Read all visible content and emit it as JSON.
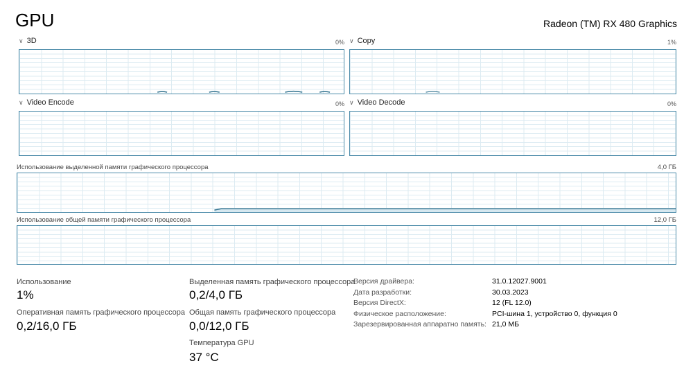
{
  "header": {
    "title": "GPU",
    "device": "Radeon (TM) RX 480 Graphics"
  },
  "engines": [
    {
      "label": "3D",
      "value": "0%"
    },
    {
      "label": "Copy",
      "value": "1%"
    },
    {
      "label": "Video Encode",
      "value": "0%"
    },
    {
      "label": "Video Decode",
      "value": "0%"
    }
  ],
  "memory_graphs": [
    {
      "label": "Использование выделенной памяти графического процессора",
      "max": "4,0 ГБ"
    },
    {
      "label": "Использование общей памяти графического процессора",
      "max": "12,0 ГБ"
    }
  ],
  "stats": {
    "utilization": {
      "label": "Использование",
      "value": "1%"
    },
    "gpu_memory": {
      "label": "Оперативная память графического процессора",
      "value": "0,2/16,0 ГБ"
    },
    "dedicated": {
      "label": "Выделенная память графического процессора",
      "value": "0,2/4,0 ГБ"
    },
    "shared": {
      "label": "Общая память графического процессора",
      "value": "0,0/12,0 ГБ"
    },
    "temperature": {
      "label": "Температура GPU",
      "value": "37 °C"
    }
  },
  "details": [
    {
      "label": "Версия драйвера:",
      "value": "31.0.12027.9001"
    },
    {
      "label": "Дата разработки:",
      "value": "30.03.2023"
    },
    {
      "label": "Версия DirectX:",
      "value": "12 (FL 12.0)"
    },
    {
      "label": "Физическое расположение:",
      "value": "PCI-шина 1, устройство 0, функция 0"
    },
    {
      "label": "Зарезервированная аппаратно память:",
      "value": "21,0 МБ"
    }
  ],
  "colors": {
    "graph_border": "#4a8aa8",
    "grid": "#dcebf2"
  }
}
